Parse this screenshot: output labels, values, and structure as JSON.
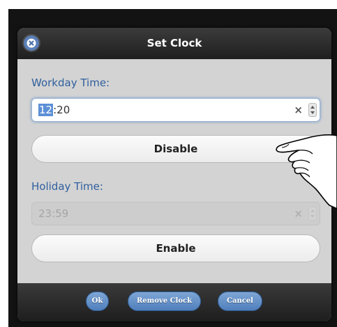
{
  "dialog": {
    "title": "Set Clock",
    "close_icon": "close-icon"
  },
  "workday": {
    "label": "Workday Time:",
    "value_hour": "12",
    "value_rest": ":20",
    "clear_symbol": "×",
    "button_label": "Disable"
  },
  "holiday": {
    "label": "Holiday Time:",
    "value": "23:59",
    "clear_symbol": "×",
    "button_label": "Enable"
  },
  "footer": {
    "ok_label": "Ok",
    "remove_label": "Remove Clock",
    "cancel_label": "Cancel"
  },
  "colors": {
    "accent": "#5c8fd6",
    "label_blue": "#2f5f9e",
    "button_blue": "#6a94cc"
  }
}
